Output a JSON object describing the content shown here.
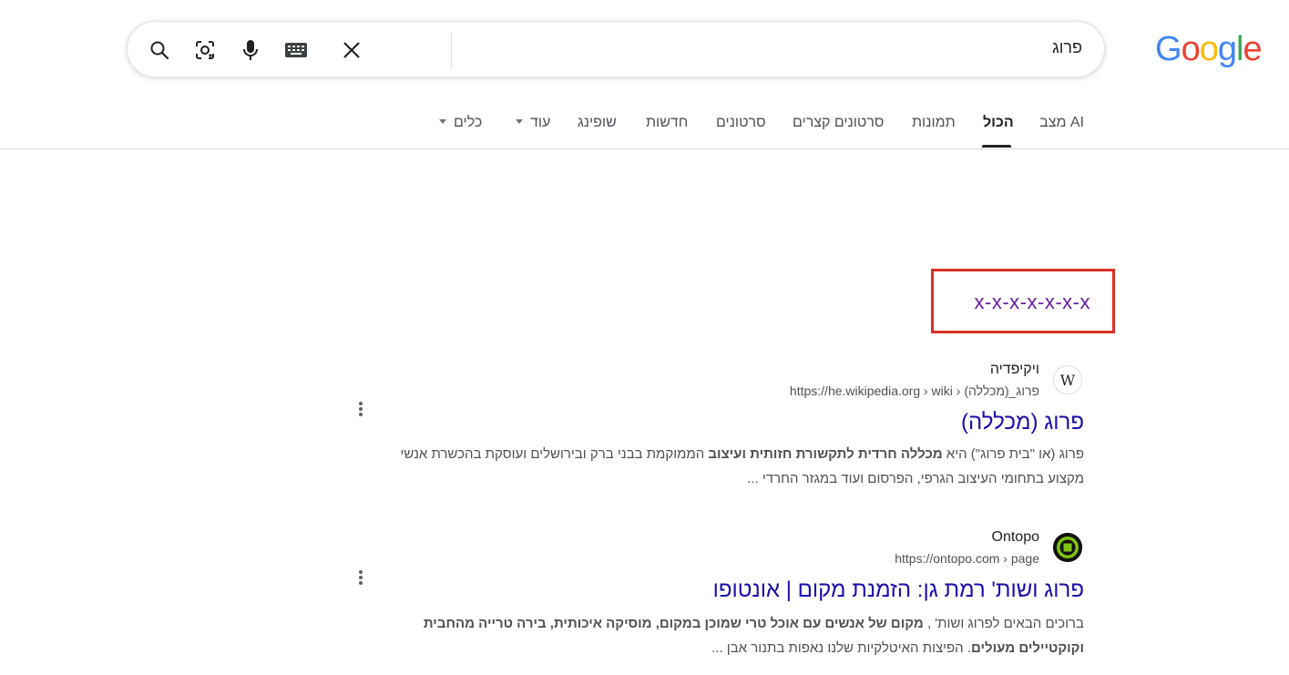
{
  "logo": {
    "letters": [
      "G",
      "o",
      "o",
      "g",
      "l",
      "e"
    ],
    "colors": [
      "#4285f4",
      "#ea4335",
      "#fbbc05",
      "#4285f4",
      "#34a853",
      "#ea4335"
    ]
  },
  "search": {
    "query": "פרוג",
    "icons": [
      "search-icon",
      "camera-lens-icon",
      "microphone-icon",
      "keyboard-icon",
      "close-icon"
    ]
  },
  "tabs": [
    {
      "label": "מצב AI"
    },
    {
      "label": "הכול"
    },
    {
      "label": "תמונות"
    },
    {
      "label": "סרטונים קצרים"
    },
    {
      "label": "סרטונים"
    },
    {
      "label": "חדשות"
    },
    {
      "label": "שופינג"
    },
    {
      "label": "עוד"
    },
    {
      "label": "כלים"
    }
  ],
  "highlight": {
    "text": "x-x-x-x-x-x-x",
    "border_color": "#d93025"
  },
  "results": [
    {
      "site_name": "ויקיפדיה",
      "url": "https://he.wikipedia.org › wiki › פרוג_(מכללה)",
      "favicon": "W",
      "title": "פרוג (מכללה)",
      "snippet_line1_a": "פרוג (או \"בית פרוג\") היא ",
      "snippet_line1_b": "מכללה חרדית לתקשורת חזותית ועיצוב",
      "snippet_line1_c": " הממוקמת בבני ברק ובירושלים ועוסקת בהכשרת אנשי",
      "snippet_line2": "מקצוע בתחומי העיצוב הגרפי, הפרסום ועוד במגזר החרדי ..."
    },
    {
      "site_name": "Ontopo",
      "url": "https://ontopo.com › page",
      "title": "פרוג ושות' רמת גן: הזמנת מקום | אונטופו",
      "snippet_line1_a": "ברוכים הבאים לפרוג ושות' , ",
      "snippet_line1_b": "מקום של אנשים עם אוכל טרי שמוכן במקום, מוסיקה איכותית, בירה טרייה מהחבית",
      "snippet_line2_a": "וקוקטיילים מעולים",
      "snippet_line2_b": ". הפיצות האיטלקיות שלנו נאפות בתנור אבן ..."
    }
  ]
}
